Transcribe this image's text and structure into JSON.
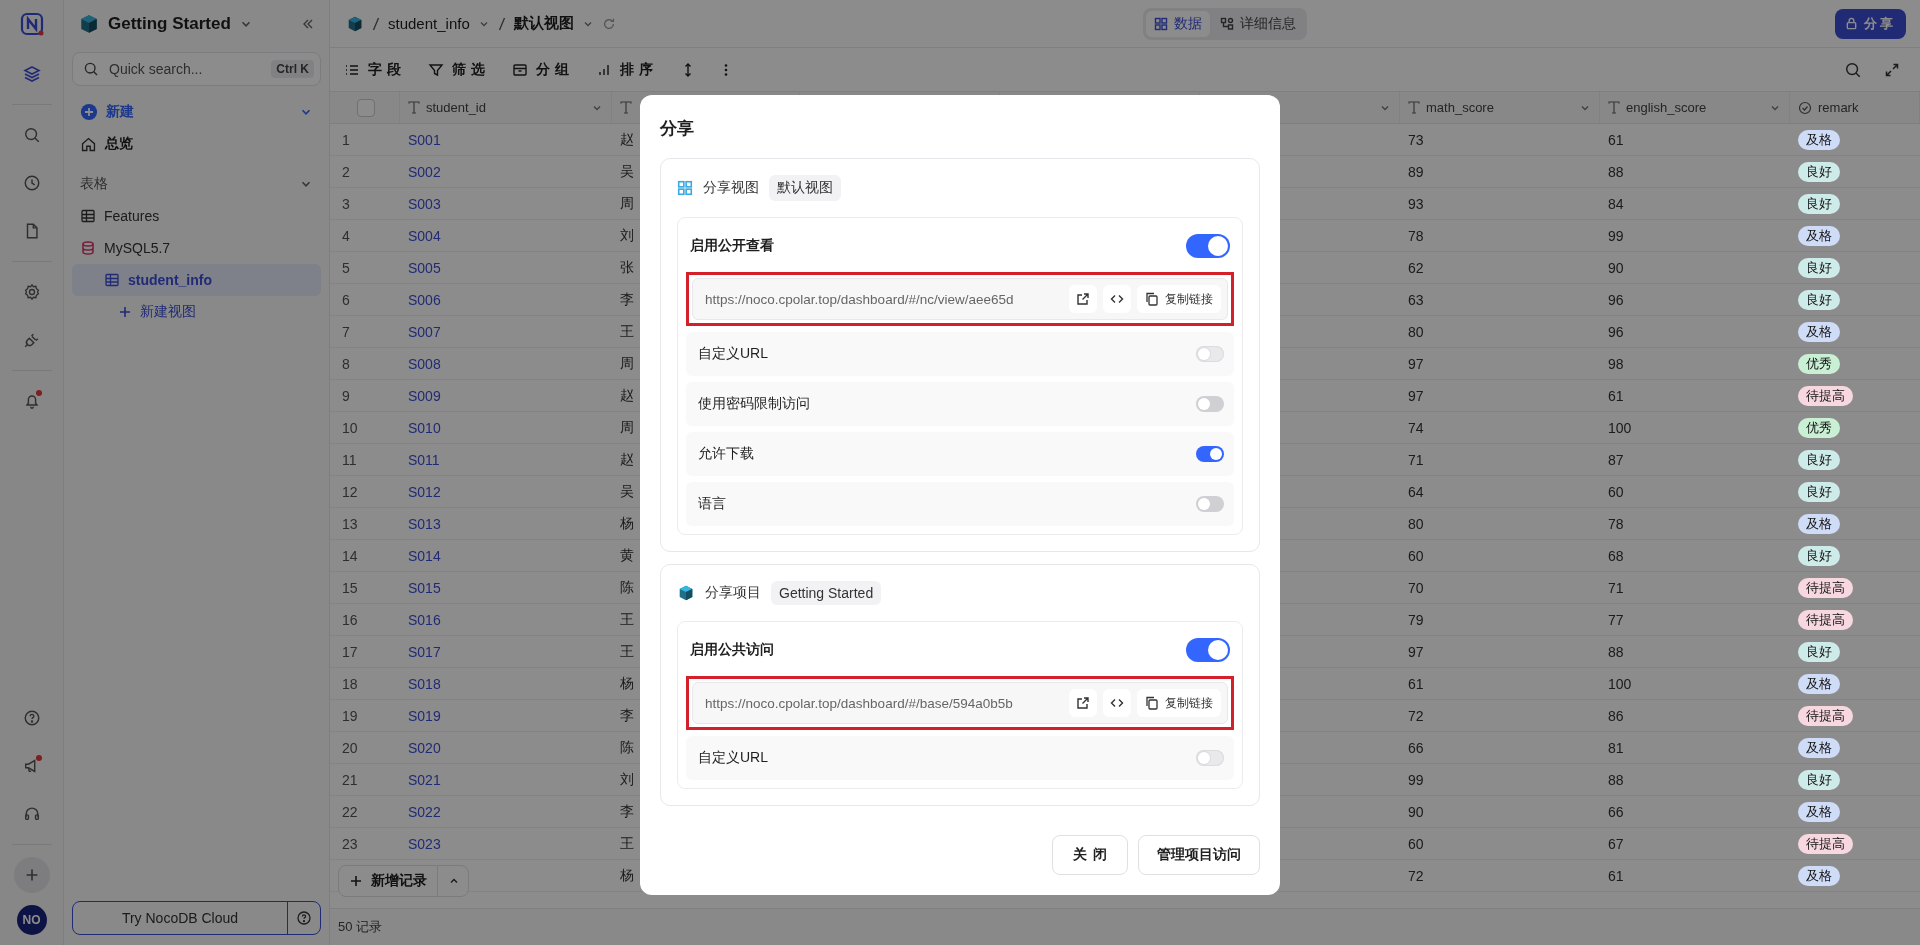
{
  "rail": {
    "top": [
      {
        "kind": "layers",
        "selected": true,
        "badge": false
      },
      {
        "kind": "search",
        "selected": false,
        "badge": false
      },
      {
        "kind": "clock",
        "selected": false,
        "badge": false
      },
      {
        "kind": "file",
        "selected": false,
        "badge": false
      },
      {
        "kind": "gear",
        "selected": false,
        "badge": false
      },
      {
        "kind": "plug",
        "selected": false,
        "badge": false
      },
      {
        "kind": "bell",
        "selected": false,
        "badge": true
      }
    ],
    "bottom": [
      {
        "kind": "help",
        "selected": false,
        "badge": false
      },
      {
        "kind": "megaphone",
        "selected": false,
        "badge": true
      },
      {
        "kind": "headset",
        "selected": false,
        "badge": false
      },
      {
        "kind": "plus",
        "selected": false,
        "badge": false
      }
    ],
    "avatar": "NO"
  },
  "sidebar": {
    "workspace": "Getting Started",
    "search": {
      "placeholder": "Quick search...",
      "shortcut": "Ctrl K"
    },
    "new_label": "新建",
    "overview": "总览",
    "section": "表格",
    "items": [
      {
        "label": "Features",
        "kind": "table",
        "selected": false
      },
      {
        "label": "MySQL5.7",
        "kind": "database",
        "selected": false,
        "children": [
          {
            "label": "student_info",
            "kind": "table",
            "selected": true
          },
          {
            "label": "新建视图",
            "kind": "new",
            "selected": false
          }
        ]
      }
    ],
    "cloud_button": "Try NocoDB Cloud"
  },
  "topbar": {
    "breadcrumb": [
      "student_info",
      "默认视图"
    ],
    "tabs": [
      {
        "label": "数据",
        "kind": "grid",
        "selected": true
      },
      {
        "label": "详细信息",
        "kind": "details",
        "selected": false
      }
    ],
    "share_button": "分享"
  },
  "toolbar": [
    {
      "label": "字段",
      "kind": "fields"
    },
    {
      "label": "筛选",
      "kind": "filter"
    },
    {
      "label": "分组",
      "kind": "group"
    },
    {
      "label": "排序",
      "kind": "sort"
    },
    {
      "kind": "height"
    },
    {
      "kind": "more"
    }
  ],
  "table": {
    "select_all": {
      "checked": false
    },
    "columns": [
      {
        "label": "student_id",
        "kind": "text"
      },
      {
        "kind": "text"
      },
      {
        "kind": "blank"
      },
      {
        "kind": "blank"
      },
      {
        "kind": "menu"
      },
      {
        "label": "math_score",
        "kind": "text"
      },
      {
        "label": "english_score",
        "kind": "text"
      },
      {
        "label": "remark",
        "kind": "select"
      }
    ],
    "rows": [
      {
        "number": "1",
        "student_id": "S001",
        "name": "赵",
        "math_score": "73",
        "english_score": "61",
        "remark": {
          "label": "及格",
          "color": "#cfdcf7"
        }
      },
      {
        "number": "2",
        "student_id": "S002",
        "name": "吴",
        "math_score": "89",
        "english_score": "88",
        "remark": {
          "label": "良好",
          "color": "#cdebe8"
        }
      },
      {
        "number": "3",
        "student_id": "S003",
        "name": "周",
        "math_score": "93",
        "english_score": "84",
        "remark": {
          "label": "良好",
          "color": "#cdebe8"
        }
      },
      {
        "number": "4",
        "student_id": "S004",
        "name": "刘",
        "math_score": "78",
        "english_score": "99",
        "remark": {
          "label": "及格",
          "color": "#cfdcf7"
        }
      },
      {
        "number": "5",
        "student_id": "S005",
        "name": "张",
        "math_score": "62",
        "english_score": "90",
        "remark": {
          "label": "良好",
          "color": "#cdebe8"
        }
      },
      {
        "number": "6",
        "student_id": "S006",
        "name": "李",
        "math_score": "63",
        "english_score": "96",
        "remark": {
          "label": "良好",
          "color": "#cdebe8"
        }
      },
      {
        "number": "7",
        "student_id": "S007",
        "name": "王",
        "math_score": "80",
        "english_score": "96",
        "remark": {
          "label": "及格",
          "color": "#cfdcf7"
        }
      },
      {
        "number": "8",
        "student_id": "S008",
        "name": "周",
        "math_score": "97",
        "english_score": "98",
        "remark": {
          "label": "优秀",
          "color": "#c9efd5"
        }
      },
      {
        "number": "9",
        "student_id": "S009",
        "name": "赵",
        "math_score": "97",
        "english_score": "61",
        "remark": {
          "label": "待提高",
          "color": "#f8d8e0"
        }
      },
      {
        "number": "10",
        "student_id": "S010",
        "name": "周",
        "math_score": "74",
        "english_score": "100",
        "remark": {
          "label": "优秀",
          "color": "#c9efd5"
        }
      },
      {
        "number": "11",
        "student_id": "S011",
        "name": "赵",
        "math_score": "71",
        "english_score": "87",
        "remark": {
          "label": "良好",
          "color": "#cdebe8"
        }
      },
      {
        "number": "12",
        "student_id": "S012",
        "name": "吴",
        "math_score": "64",
        "english_score": "60",
        "remark": {
          "label": "良好",
          "color": "#cdebe8"
        }
      },
      {
        "number": "13",
        "student_id": "S013",
        "name": "杨",
        "math_score": "80",
        "english_score": "78",
        "remark": {
          "label": "及格",
          "color": "#cfdcf7"
        }
      },
      {
        "number": "14",
        "student_id": "S014",
        "name": "黄",
        "math_score": "60",
        "english_score": "68",
        "remark": {
          "label": "良好",
          "color": "#cdebe8"
        }
      },
      {
        "number": "15",
        "student_id": "S015",
        "name": "陈",
        "math_score": "70",
        "english_score": "71",
        "remark": {
          "label": "待提高",
          "color": "#f8d8e0"
        }
      },
      {
        "number": "16",
        "student_id": "S016",
        "name": "王",
        "math_score": "79",
        "english_score": "77",
        "remark": {
          "label": "待提高",
          "color": "#f8d8e0"
        }
      },
      {
        "number": "17",
        "student_id": "S017",
        "name": "王",
        "math_score": "97",
        "english_score": "88",
        "remark": {
          "label": "良好",
          "color": "#cdebe8"
        }
      },
      {
        "number": "18",
        "student_id": "S018",
        "name": "杨",
        "math_score": "61",
        "english_score": "100",
        "remark": {
          "label": "及格",
          "color": "#cfdcf7"
        }
      },
      {
        "number": "19",
        "student_id": "S019",
        "name": "李",
        "math_score": "72",
        "english_score": "86",
        "remark": {
          "label": "待提高",
          "color": "#f8d8e0"
        }
      },
      {
        "number": "20",
        "student_id": "S020",
        "name": "陈",
        "math_score": "66",
        "english_score": "81",
        "remark": {
          "label": "及格",
          "color": "#cfdcf7"
        }
      },
      {
        "number": "21",
        "student_id": "S021",
        "name": "刘",
        "math_score": "99",
        "english_score": "88",
        "remark": {
          "label": "良好",
          "color": "#cdebe8"
        }
      },
      {
        "number": "22",
        "student_id": "S022",
        "name": "李",
        "math_score": "90",
        "english_score": "66",
        "remark": {
          "label": "及格",
          "color": "#cfdcf7"
        }
      },
      {
        "number": "23",
        "student_id": "S023",
        "name": "王",
        "math_score": "60",
        "english_score": "67",
        "remark": {
          "label": "待提高",
          "color": "#f8d8e0"
        }
      },
      {
        "name": "杨",
        "math_score": "72",
        "english_score": "61",
        "remark": {
          "label": "及格",
          "color": "#cfdcf7"
        }
      }
    ],
    "add_record": "新增记录",
    "status": "50 记录"
  },
  "dialog": {
    "title": "分享",
    "sections": [
      {
        "kind": "view",
        "label": "分享视图",
        "target": "默认视图",
        "access": {
          "label": "启用公开查看",
          "on": true
        },
        "link": {
          "url": "https://noco.cpolar.top/dashboard/#/nc/view/aee65d",
          "copy": "复制链接",
          "highlighted": true
        },
        "options": [
          {
            "label": "自定义URL",
            "on": false,
            "disabled": true
          },
          {
            "label": "使用密码限制访问",
            "on": false,
            "disabled": false
          },
          {
            "label": "允许下载",
            "on": true,
            "disabled": false
          },
          {
            "label": "语言",
            "on": false,
            "disabled": false
          }
        ]
      },
      {
        "kind": "base",
        "label": "分享项目",
        "target": "Getting Started",
        "access": {
          "label": "启用公共访问",
          "on": true
        },
        "link": {
          "url": "https://noco.cpolar.top/dashboard/#/base/594a0b5b",
          "copy": "复制链接",
          "highlighted": true
        },
        "options": [
          {
            "label": "自定义URL",
            "on": false,
            "disabled": true
          }
        ]
      }
    ],
    "buttons": [
      {
        "label": "关闭",
        "kind": "close"
      },
      {
        "label": "管理项目访问",
        "kind": "manage"
      }
    ]
  }
}
